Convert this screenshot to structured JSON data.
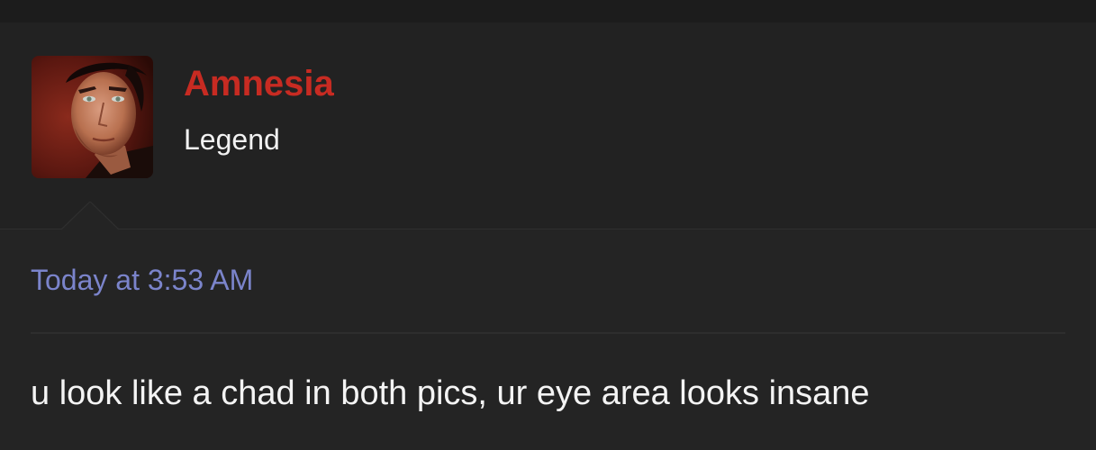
{
  "post": {
    "author": {
      "name": "Amnesia",
      "title": "Legend",
      "name_color": "#c72b22",
      "avatar_icon": "user-avatar-photo"
    },
    "timestamp": "Today at 3:53 AM",
    "timestamp_color": "#7b84cb",
    "message": "u look like a chad in both pics, ur eye area looks insane"
  },
  "theme": {
    "background": "#232323",
    "header_background": "#222222",
    "text_color": "#f4f4f4"
  }
}
